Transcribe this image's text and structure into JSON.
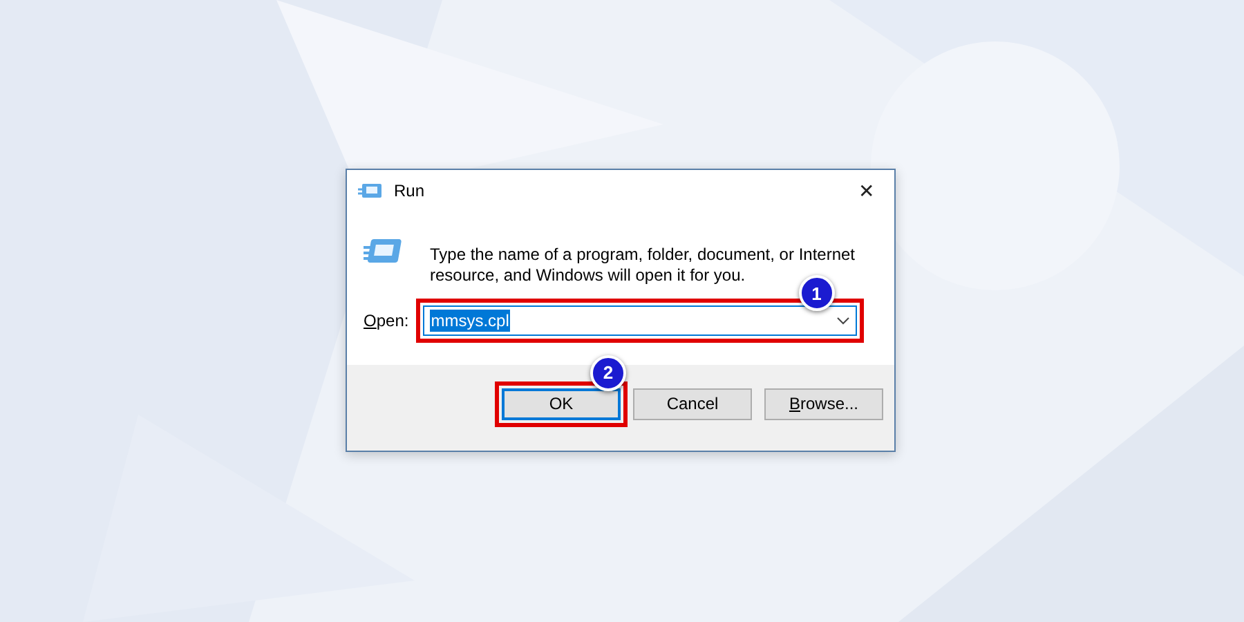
{
  "window": {
    "title": "Run",
    "close": "✕"
  },
  "message": "Type the name of a program, folder, document, or Internet resource, and Windows will open it for you.",
  "open_field": {
    "label": "Open:",
    "value": "mmsys.cpl",
    "selected_text": true,
    "callout": "1"
  },
  "buttons": [
    {
      "label": "OK",
      "focused": true,
      "callout": "2"
    },
    {
      "label": "Cancel",
      "focused": false
    },
    {
      "label": "Browse...",
      "focused": false
    }
  ]
}
